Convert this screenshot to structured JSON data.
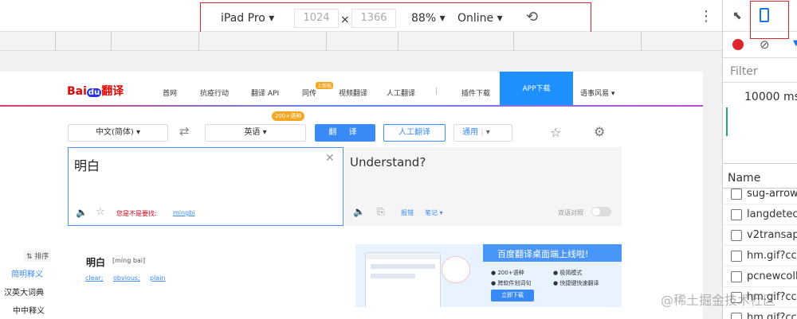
{
  "device_toolbar": {
    "device": "iPad Pro",
    "width": "1024",
    "times": "×",
    "height": "1366",
    "zoom": "88%",
    "network": "Online"
  },
  "site": {
    "logo_left": "Bai",
    "logo_mid": "du",
    "logo_right": "翻译",
    "nav": [
      "首网",
      "抗疫行动",
      "翻译 API",
      "同传",
      "视频翻译",
      "人工翻译",
      "|",
      "插件下载"
    ],
    "new_badge": "上新啦",
    "app_button": "APP下载",
    "user_menu": "语事风易"
  },
  "translator": {
    "source_lang": "中文(简体)",
    "target_lang": "英语",
    "lang_badge": "200+语种",
    "translate_label": "翻 译",
    "human_label": "人工翻译",
    "domain_select": "通用",
    "source_text": "明白",
    "target_text": "Understand?",
    "suggest_prefix": "您是不是要找:",
    "suggest_word": "mingbi",
    "report": "报错",
    "notes": "笔记",
    "contrast": "双语对照"
  },
  "dictionary": {
    "sort": "排序",
    "tabs": [
      "简明释义",
      "汉英大词典",
      "中中释义"
    ],
    "word": "明白",
    "pinyin": "[míng bai]",
    "meanings": [
      "clear;",
      "obvious;",
      "plain"
    ]
  },
  "ad": {
    "title": "百度翻译桌面端上线啦!",
    "features": [
      "200+语种",
      "极简模式",
      "跨软件划词句",
      "快捷键快速翻译"
    ],
    "cta": "立即下载"
  },
  "devtools": {
    "filter_placeholder": "Filter",
    "timeline": "10000 ms",
    "name_header": "Name",
    "requests": [
      "sug-arrow",
      "langdetect",
      "v2transapi",
      "hm.gif?cc=",
      "pcnewcoll",
      "hm.gif?cc=",
      "hm.gif?cc="
    ]
  },
  "watermark": "@稀土掘金技术社区"
}
